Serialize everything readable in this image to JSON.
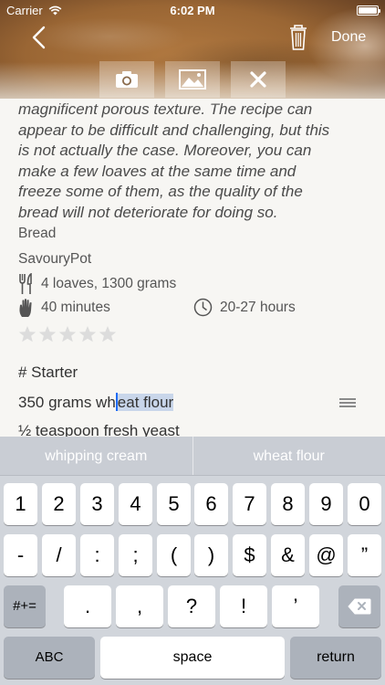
{
  "status": {
    "carrier": "Carrier",
    "time": "6:02 PM"
  },
  "nav": {
    "done": "Done"
  },
  "recipe": {
    "description_lines": [
      "magnificent porous texture. The recipe can",
      "appear to be difficult and challenging, but this",
      "is not actually the case. Moreover, you can",
      "make a few loaves at the same time and",
      "freeze some of them, as the quality of the",
      "bread will not deteriorate for doing so."
    ],
    "category": "Bread",
    "source": "SavouryPot",
    "yield": "4 loaves, 1300 grams",
    "prep_time": "40 minutes",
    "total_time": "20-27 hours",
    "rating": 0,
    "rating_max": 5,
    "section_heading": "# Starter",
    "ingredient_before": "350 grams wh",
    "ingredient_selected": "eat flour",
    "ingredient_next": "½ teaspoon fresh yeast"
  },
  "keyboard": {
    "suggestions": [
      "whipping cream",
      "wheat flour"
    ],
    "row1": [
      "1",
      "2",
      "3",
      "4",
      "5",
      "6",
      "7",
      "8",
      "9",
      "0"
    ],
    "row2": [
      "-",
      "/",
      ":",
      ";",
      "(",
      ")",
      "$",
      "&",
      "@",
      "”"
    ],
    "row3_left": "#+=",
    "row3": [
      ".",
      ",",
      "?",
      "!",
      "’"
    ],
    "abc": "ABC",
    "space": "space",
    "return": "return"
  },
  "icons": {
    "back": "chevron-left-icon",
    "trash": "trash-icon",
    "camera": "camera-icon",
    "photo": "photo-library-icon",
    "remove": "close-icon",
    "yield": "fork-knife-icon",
    "prep": "hand-icon",
    "time": "clock-icon",
    "backspace": "backspace-icon"
  },
  "colors": {
    "selection": "#c9d6ea",
    "cursor": "#1f6cf4"
  }
}
